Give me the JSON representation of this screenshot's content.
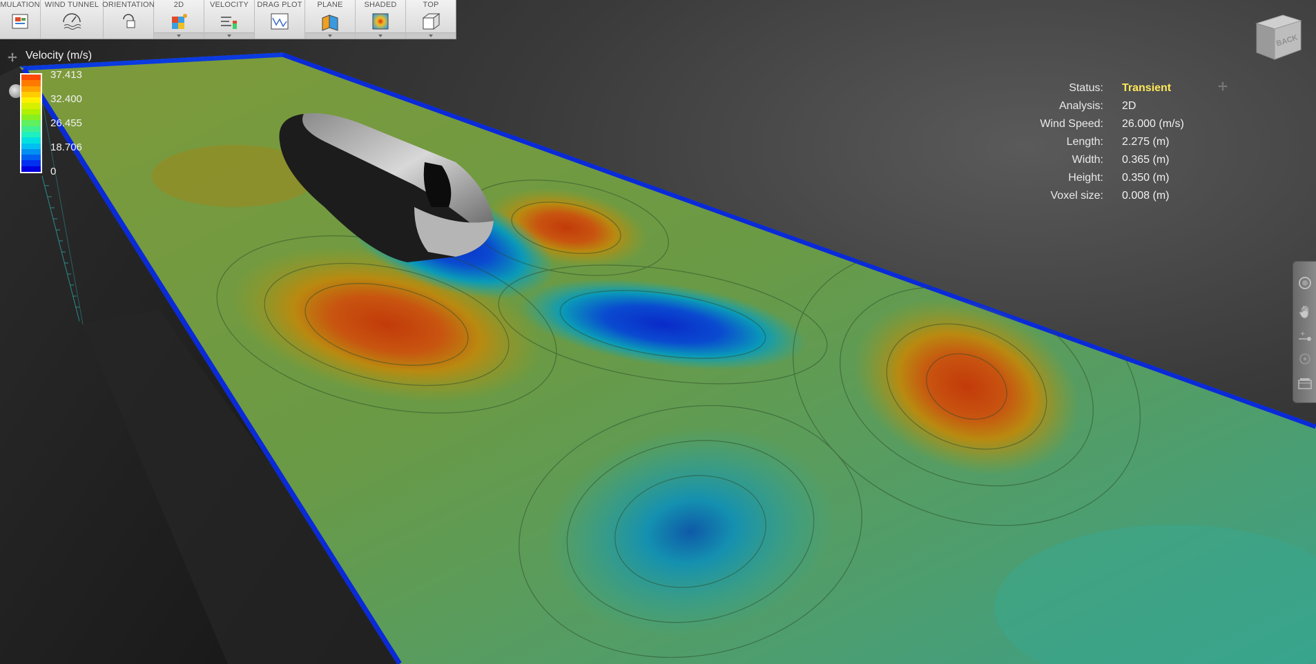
{
  "toolbar": {
    "items": [
      {
        "label": "MULATION",
        "icon": "simulation-icon",
        "caret": false
      },
      {
        "label": "WIND TUNNEL",
        "icon": "wind-tunnel-icon",
        "caret": false
      },
      {
        "label": "ORIENTATION",
        "icon": "orientation-icon",
        "caret": false
      },
      {
        "label": "2D",
        "icon": "analysis-2d-icon",
        "caret": true
      },
      {
        "label": "VELOCITY",
        "icon": "velocity-icon",
        "caret": true
      },
      {
        "label": "DRAG PLOT",
        "icon": "drag-plot-icon",
        "caret": false
      },
      {
        "label": "PLANE",
        "icon": "plane-icon",
        "caret": true
      },
      {
        "label": "SHADED",
        "icon": "shaded-icon",
        "caret": true
      },
      {
        "label": "TOP",
        "icon": "top-view-icon",
        "caret": true
      }
    ]
  },
  "legend": {
    "title": "Velocity (m/s)",
    "labels": [
      "37.413",
      "32.400",
      "26.455",
      "18.706",
      "0"
    ],
    "colors": [
      "#ff4a00",
      "#ff7a00",
      "#ffa400",
      "#ffcc00",
      "#fff000",
      "#d8f000",
      "#b0f000",
      "#88f020",
      "#60f060",
      "#40f090",
      "#20f0c0",
      "#00e0e0",
      "#00c0f0",
      "#0090f0",
      "#0060f0",
      "#0030f0",
      "#0000e0"
    ]
  },
  "info": [
    {
      "key": "Status:",
      "value": "Transient"
    },
    {
      "key": "Analysis:",
      "value": "2D"
    },
    {
      "key": "Wind Speed:",
      "value": "26.000 (m/s)"
    },
    {
      "key": "Length:",
      "value": "2.275 (m)"
    },
    {
      "key": "Width:",
      "value": "0.365 (m)"
    },
    {
      "key": "Height:",
      "value": "0.350 (m)"
    },
    {
      "key": "Voxel size:",
      "value": "0.008 (m)"
    }
  ],
  "viewcube": {
    "face_label": "BACK"
  },
  "nav": {
    "icons": [
      "steering-wheel-icon",
      "pan-hand-icon",
      "zoom-slider-icon",
      "orbit-icon",
      "film-strip-icon"
    ]
  }
}
